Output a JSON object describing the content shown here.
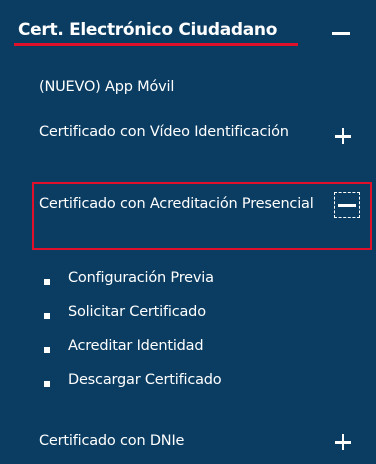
{
  "section": {
    "title": "Cert. Electrónico Ciudadano",
    "toggle_icon": "minus-icon"
  },
  "items": [
    {
      "label": "(NUEVO) App Móvil"
    },
    {
      "label": "Certificado con Vídeo Identificación",
      "toggle_icon": "plus-icon"
    },
    {
      "label": "Certificado con Acreditación Presencial",
      "toggle_icon": "minus-icon",
      "expanded": true
    },
    {
      "label": "Certificado con DNIe",
      "toggle_icon": "plus-icon"
    }
  ],
  "sub_items": [
    "Configuración Previa",
    "Solicitar Certificado",
    "Acreditar Identidad",
    "Descargar Certificado"
  ],
  "colors": {
    "background": "#0b3d63",
    "text": "#ffffff",
    "highlight": "#e0102a"
  }
}
